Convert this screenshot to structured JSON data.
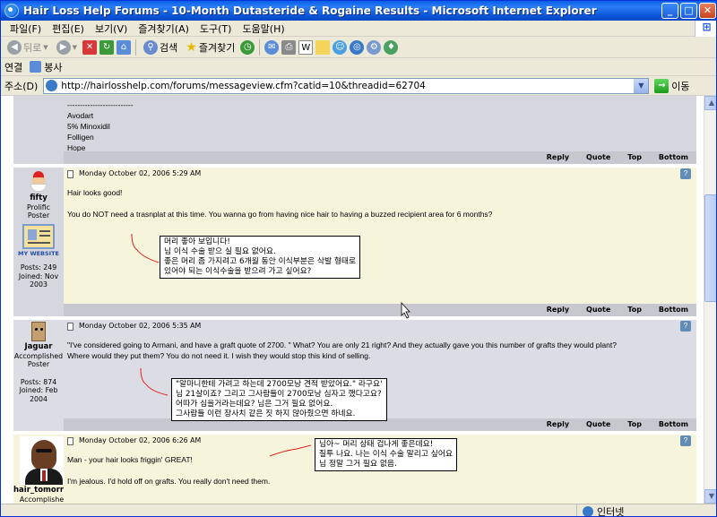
{
  "window": {
    "title": "Hair Loss Help Forums - 10-Month Dutasteride & Rogaine Results - Microsoft Internet Explorer",
    "min": "_",
    "max": "□",
    "close": "✕"
  },
  "menu": [
    "파일(F)",
    "편집(E)",
    "보기(V)",
    "즐겨찾기(A)",
    "도구(T)",
    "도움말(H)"
  ],
  "toolbar": {
    "back": "뒤로",
    "forward": "",
    "search": "검색",
    "favorites": "즐겨찾기"
  },
  "links": {
    "label": "연결",
    "item": "봉사"
  },
  "address": {
    "label": "주소(D)",
    "url": "http://hairlosshelp.com/forums/messageview.cfm?catid=10&threadid=62704",
    "go": "이동"
  },
  "status": {
    "zone": "인터넷"
  },
  "footer_labels": {
    "reply": "Reply",
    "quote": "Quote",
    "top": "Top",
    "bottom": "Bottom"
  },
  "post0": {
    "divider": "--------------------------",
    "lines": [
      "Avodart",
      "5% Minoxidil",
      "Folligen",
      "Hope"
    ]
  },
  "post1": {
    "author": "fifty",
    "rank1": "Prolific",
    "rank2": "Poster",
    "website": "MY WEBSITE",
    "posts": "Posts: 249",
    "joined": "Joined: Nov",
    "year": "2003",
    "date": "Monday October 02, 2006 5:29 AM",
    "line1": "Hair looks good!",
    "line2": "You do NOT need a trasnplat at this time. You wanna go from having nice hair to having a buzzed recipient area for 6 months?",
    "note": [
      "머리 좋아 보입니다!",
      "님 이식 수술 받으 실 필요 없어요.",
      "좋은 머리 좀 가지려고 6개월 동안 이식부분은 삭발 형태로",
      "있어야 되는 이식수술을 받으려 가고 싶어요?"
    ]
  },
  "post2": {
    "author": "Jaguar",
    "rank1": "Accomplished",
    "rank2": "Poster",
    "posts": "Posts: 874",
    "joined": "Joined: Feb",
    "year": "2004",
    "date": "Monday October 02, 2006 5:35 AM",
    "line1": "\"I've considered going to Armani, and have a graft quote of 2700. \" What? You are only 21 right? And they actually gave you this number of grafts they would plant?",
    "line2": "Where would they put them? You do not need it. I wish they would stop this kind of selling.",
    "note": [
      "\"알마니한테 가려고 하는데 2700모낭 견적 받았어요.\" 라구요'",
      "님 21살이죠? 그리고 그사람들이 2700모낭 심자고 했다고요?",
      "어따가 심을거라는데요? 님은 그거 필요 없어요.",
      "그사람들 이런 장사치 같은 짓 하지 않아줬으면 하네요."
    ]
  },
  "post3": {
    "author": "hair_tomorrow",
    "rank1": "Accomplished",
    "date": "Monday October 02, 2006 6:26 AM",
    "line1": "Man - your hair looks friggin' GREAT!",
    "line2": "I'm jealous.  I'd hold off on grafts.  You really don't need them.",
    "note": [
      "님아~ 머리 상태 겁나게 좋은데요!",
      "질투 나요. 나는 이식 수술 말리고 싶어요",
      "님 정말 그거 필요 없음."
    ]
  },
  "colors": {
    "titlebar": "#0a5fe8",
    "post_gray": "#d6d6de",
    "post_cream": "#f7f4dc",
    "annotation_red": "#e02020"
  }
}
